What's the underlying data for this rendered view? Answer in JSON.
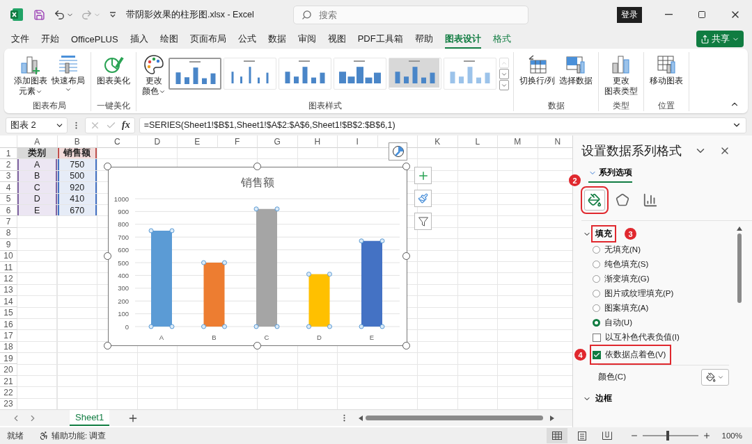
{
  "window": {
    "title": "带阴影效果的柱形图.xlsx  -  Excel",
    "search_placeholder": "搜索",
    "sign_in": "登录"
  },
  "ribbon_tabs": [
    {
      "label": "文件",
      "selected": false,
      "contextual": false
    },
    {
      "label": "开始",
      "selected": false,
      "contextual": false
    },
    {
      "label": "OfficePLUS",
      "selected": false,
      "contextual": false
    },
    {
      "label": "插入",
      "selected": false,
      "contextual": false
    },
    {
      "label": "绘图",
      "selected": false,
      "contextual": false
    },
    {
      "label": "页面布局",
      "selected": false,
      "contextual": false
    },
    {
      "label": "公式",
      "selected": false,
      "contextual": false
    },
    {
      "label": "数据",
      "selected": false,
      "contextual": false
    },
    {
      "label": "审阅",
      "selected": false,
      "contextual": false
    },
    {
      "label": "视图",
      "selected": false,
      "contextual": false
    },
    {
      "label": "PDF工具箱",
      "selected": false,
      "contextual": false
    },
    {
      "label": "帮助",
      "selected": false,
      "contextual": false
    },
    {
      "label": "图表设计",
      "selected": true,
      "contextual": true
    },
    {
      "label": "格式",
      "selected": false,
      "contextual": true
    }
  ],
  "share_button": "共享",
  "ribbon_groups": [
    {
      "label": "图表布局",
      "commands": [
        {
          "lines": [
            "添加图表",
            "元素"
          ],
          "dropdown": true
        },
        {
          "lines": [
            "快速布局"
          ],
          "dropdown": true
        }
      ]
    },
    {
      "label": "一键美化",
      "commands": [
        {
          "lines": [
            "图表美化"
          ]
        }
      ]
    },
    {
      "label": "图表样式",
      "commands": [
        {
          "lines": [
            "更改",
            "颜色"
          ],
          "dropdown": true
        }
      ],
      "styles": [
        {
          "selected": true
        },
        {
          "selected": false
        },
        {
          "selected": false
        },
        {
          "selected": false
        },
        {
          "selected": false
        },
        {
          "selected": false
        }
      ]
    },
    {
      "label": "数据",
      "commands": [
        {
          "lines": [
            "切换行/列"
          ]
        },
        {
          "lines": [
            "选择数据"
          ]
        }
      ]
    },
    {
      "label": "类型",
      "commands": [
        {
          "lines": [
            "更改",
            "图表类型"
          ]
        }
      ]
    },
    {
      "label": "位置",
      "commands": [
        {
          "lines": [
            "移动图表"
          ]
        }
      ]
    }
  ],
  "formula_bar": {
    "name_box": "图表 2",
    "function_label": "fx",
    "formula": "=SERIES(Sheet1!$B$1,Sheet1!$A$2:$A$6,Sheet1!$B$2:$B$6,1)"
  },
  "sheet": {
    "columns": [
      "A",
      "B",
      "C",
      "D",
      "E",
      "F",
      "G",
      "H",
      "I",
      null,
      "K",
      "L",
      "M",
      "N"
    ],
    "rows": [
      {
        "number": "1",
        "cells": [
          "类别",
          "销售额"
        ]
      },
      {
        "number": "2",
        "cells": [
          "A",
          "750"
        ]
      },
      {
        "number": "3",
        "cells": [
          "B",
          "500"
        ]
      },
      {
        "number": "4",
        "cells": [
          "C",
          "920"
        ]
      },
      {
        "number": "5",
        "cells": [
          "D",
          "410"
        ]
      },
      {
        "number": "6",
        "cells": [
          "E",
          "670"
        ]
      },
      {
        "number": "7"
      },
      {
        "number": "8"
      },
      {
        "number": "9"
      },
      {
        "number": "10"
      },
      {
        "number": "11"
      },
      {
        "number": "12"
      },
      {
        "number": "13"
      },
      {
        "number": "14"
      },
      {
        "number": "15"
      },
      {
        "number": "16"
      },
      {
        "number": "17"
      },
      {
        "number": "18"
      },
      {
        "number": "19"
      },
      {
        "number": "20"
      },
      {
        "number": "21"
      },
      {
        "number": "22"
      },
      {
        "number": "23"
      }
    ]
  },
  "chart": {
    "selected": true,
    "chart_data": {
      "type": "bar",
      "title": "销售额",
      "categories": [
        "A",
        "B",
        "C",
        "D",
        "E"
      ],
      "stacked": true,
      "grid": true,
      "series": [
        {
          "color": "#5b9bd5",
          "values": [
            750,
            null,
            null,
            null,
            null
          ]
        },
        {
          "color": "#ed7d31",
          "values": [
            null,
            500,
            null,
            null,
            null
          ]
        },
        {
          "color": "#a5a5a5",
          "values": [
            null,
            null,
            920,
            null,
            null
          ]
        },
        {
          "color": "#ffc000",
          "values": [
            null,
            null,
            null,
            410,
            null
          ]
        },
        {
          "color": "#4472c4",
          "values": [
            null,
            null,
            null,
            null,
            670
          ]
        }
      ],
      "ylim": [
        0,
        1000
      ],
      "yticks": [
        0,
        100,
        200,
        300,
        400,
        500,
        600,
        700,
        800,
        900,
        1000
      ]
    }
  },
  "pane": {
    "title": "设置数据系列格式",
    "tab": {
      "label": "系列选项",
      "selected": true
    },
    "icon_tabs": [
      {
        "selected": true,
        "callout": "2"
      },
      {
        "selected": false
      },
      {
        "selected": false
      }
    ],
    "sections": [
      {
        "label": "填充",
        "expanded": true,
        "callout": "3",
        "options": [
          {
            "kind": "radio",
            "label": "无填充(N)",
            "selected": false
          },
          {
            "kind": "radio",
            "label": "纯色填充(S)",
            "selected": false
          },
          {
            "kind": "radio",
            "label": "渐变填充(G)",
            "selected": false
          },
          {
            "kind": "radio",
            "label": "图片或纹理填充(P)",
            "selected": false
          },
          {
            "kind": "radio",
            "label": "图案填充(A)",
            "selected": false
          },
          {
            "kind": "radio",
            "label": "自动(U)",
            "selected": true
          },
          {
            "kind": "checkbox",
            "label": "以互补色代表负值(I)",
            "checked": false
          },
          {
            "kind": "checkbox",
            "label": "依数据点着色(V)",
            "checked": true,
            "callout": "4"
          },
          {
            "kind": "color",
            "label": "颜色(C)"
          }
        ]
      },
      {
        "label": "边框",
        "expanded": true
      }
    ]
  },
  "sheet_tabs": [
    {
      "label": "Sheet1",
      "selected": true
    }
  ],
  "status_bar": {
    "ready": "就绪",
    "accessibility": "辅助功能: 调查",
    "views": [
      {
        "selected": true
      },
      {
        "selected": false
      },
      {
        "selected": false
      }
    ],
    "zoom": {
      "level": 0.45,
      "reading": "100%"
    }
  }
}
